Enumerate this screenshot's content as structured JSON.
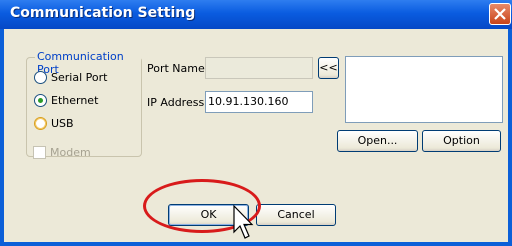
{
  "window": {
    "title": "Communication Setting"
  },
  "port_group": {
    "label": "Communication Port",
    "options": [
      {
        "label": "Serial Port",
        "selected": false
      },
      {
        "label": "Ethernet",
        "selected": true
      },
      {
        "label": "USB",
        "selected": false
      }
    ]
  },
  "modem": {
    "label": "Modem",
    "checked": false,
    "enabled": false
  },
  "port_name": {
    "label": "Port Name",
    "value": ""
  },
  "ip_address": {
    "label": "IP Address",
    "value": "10.91.130.160"
  },
  "browse_button": {
    "label": "<<"
  },
  "buttons": {
    "open": "Open...",
    "option": "Option",
    "ok": "OK",
    "cancel": "Cancel"
  },
  "colors": {
    "title_bar": "#0a5ce0",
    "highlight_ring": "#d81b1b",
    "dialog_bg": "#ece9d8"
  },
  "icons": {
    "close": "close-icon",
    "cursor": "mouse-pointer-icon"
  }
}
